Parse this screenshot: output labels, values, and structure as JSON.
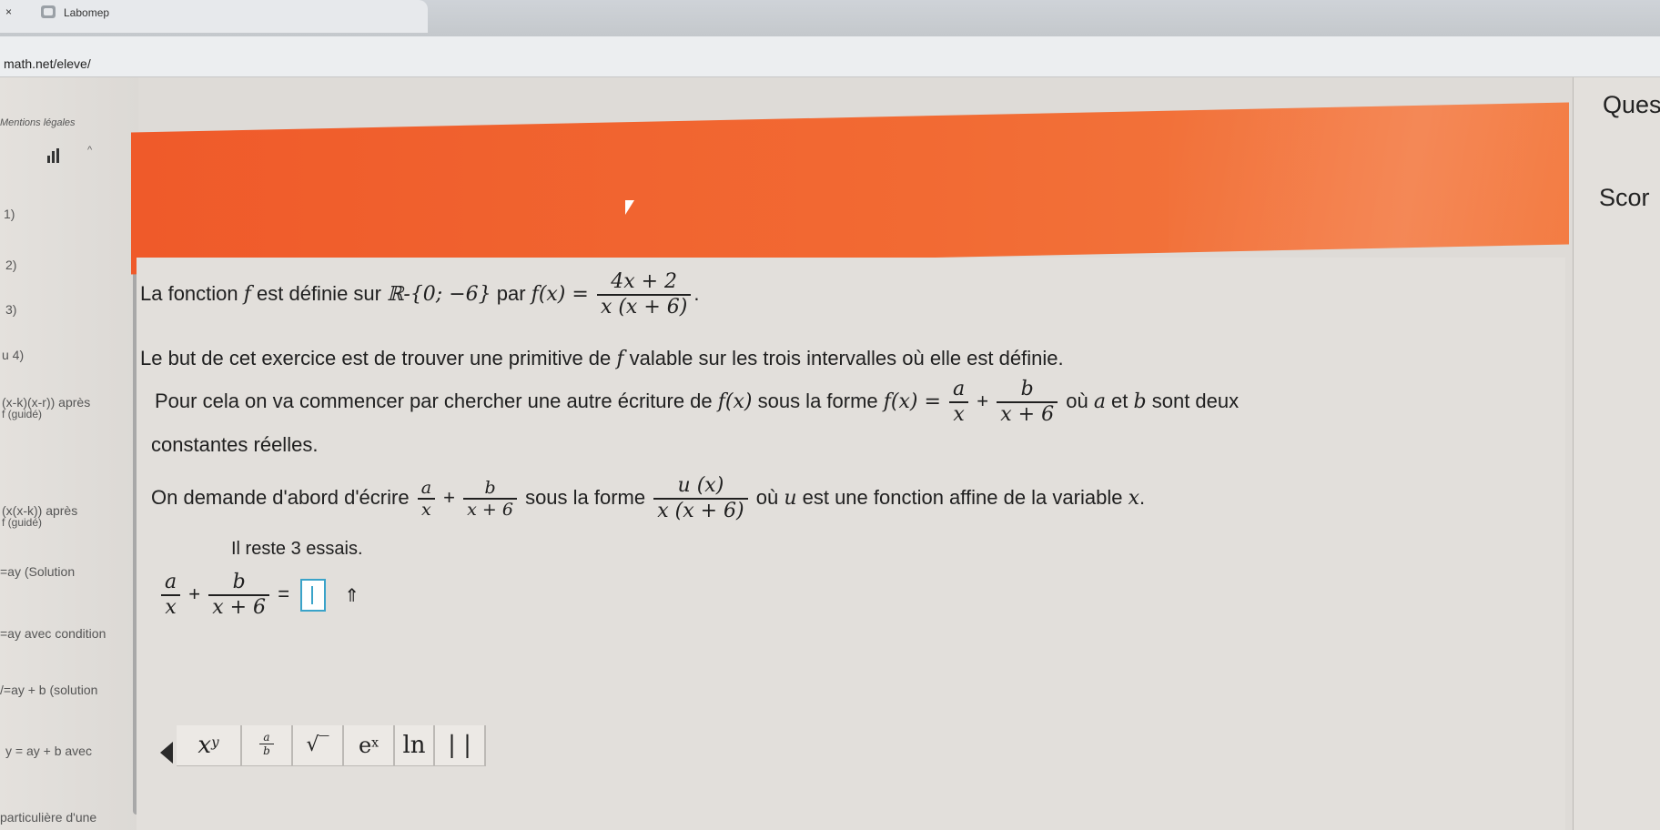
{
  "browser": {
    "tab_close": "×",
    "tab_title": "Labomep",
    "url": "math.net/eleve/"
  },
  "sidebar": {
    "legal": "Mentions légales",
    "items": [
      {
        "label": "1)"
      },
      {
        "label": "2)"
      },
      {
        "label": "3)"
      },
      {
        "label": "u 4)"
      },
      {
        "label": "(x-k)(x-r)) après",
        "sub": "f (guidé)"
      },
      {
        "label": "(x(x-k)) après",
        "sub": "f (guidé)"
      },
      {
        "label": "=ay (Solution"
      },
      {
        "label": "=ay avec condition"
      },
      {
        "label": "/=ay + b (solution"
      },
      {
        "label": "y = ay + b avec"
      },
      {
        "label": "particulière d'une"
      }
    ]
  },
  "right_panel": {
    "title": "Ques",
    "score": "Scor"
  },
  "exercise": {
    "l1_a": "La fonction ",
    "l1_f": "f",
    "l1_b": " est définie sur ",
    "l1_domain": "ℝ-{0; −6}",
    "l1_c": " par ",
    "l1_fx": "f(x) =",
    "l1_num": "4x + 2",
    "l1_den": "x (x + 6)",
    "l1_end": ".",
    "l2_a": "Le but de cet exercice est de trouver une primitive de ",
    "l2_f": "f",
    "l2_b": " valable sur les trois intervalles où elle est définie.",
    "l3_a": "Pour cela on va commencer par chercher une autre écriture de ",
    "l3_fx": "f(x)",
    "l3_b": " sous la forme ",
    "l3_fx2": "f(x) =",
    "l3_na": "a",
    "l3_da": "x",
    "l3_plus": "+",
    "l3_nb": "b",
    "l3_db": "x + 6",
    "l3_c": " où ",
    "l3_a_var": "a",
    "l3_d": " et ",
    "l3_b_var": "b",
    "l3_e": " sont deux",
    "l4": "constantes réelles.",
    "l5_a": "On demande d'abord d'écrire ",
    "l5_na": "a",
    "l5_da": "x",
    "l5_plus": "+",
    "l5_nb": "b",
    "l5_db": "x + 6",
    "l5_b": " sous la forme ",
    "l5_nu": "u (x)",
    "l5_du": "x (x + 6)",
    "l5_c": " où ",
    "l5_u": "u",
    "l5_d": " est une fonction affine de la variable ",
    "l5_x": "x",
    "l5_end": ".",
    "attempts": "Il reste 3 essais.",
    "ans_na": "a",
    "ans_da": "x",
    "ans_plus": "+",
    "ans_nb": "b",
    "ans_db": "x + 6",
    "ans_eq": "=",
    "ans_up": "⇑"
  },
  "toolbar": {
    "power": "x",
    "power_sup": "y",
    "frac_num": "a",
    "frac_den": "b",
    "sqrt": "√‾",
    "exp": "e",
    "exp_sup": "x",
    "ln": "ln",
    "abs": "| |"
  }
}
